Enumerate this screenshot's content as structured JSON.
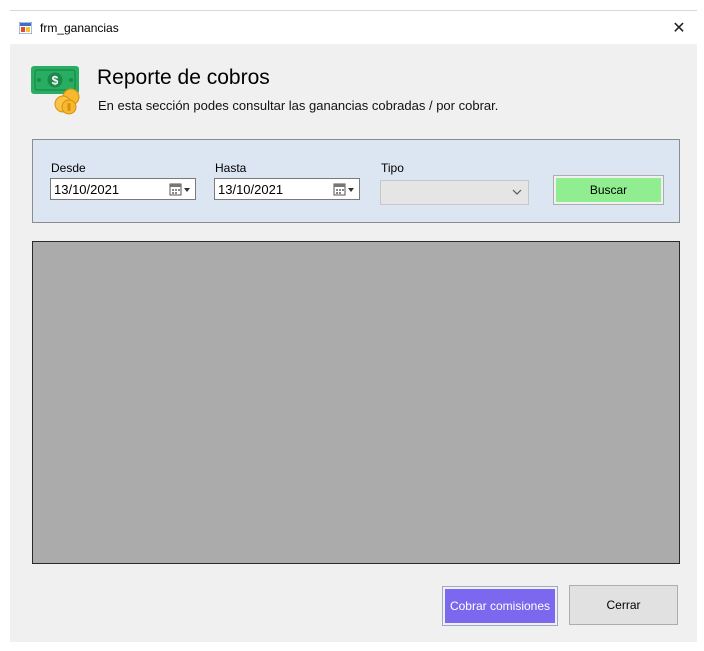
{
  "window": {
    "title": "frm_ganancias",
    "close_glyph": "✕"
  },
  "header": {
    "title": "Reporte de cobros",
    "subtitle": "En esta sección podes consultar las ganancias cobradas / por cobrar.",
    "icon": "money-icon"
  },
  "filters": {
    "from_label": "Desde",
    "from_value": "13/10/2021",
    "to_label": "Hasta",
    "to_value": "13/10/2021",
    "type_label": "Tipo",
    "type_value": "",
    "search_label": "Buscar"
  },
  "actions": {
    "charge_label": "Cobrar comisiones",
    "close_label": "Cerrar"
  },
  "colors": {
    "panel_bg": "#dce6f2",
    "search_bg": "#90ee90",
    "charge_bg": "#7b68ee",
    "grid_bg": "#ababab"
  }
}
